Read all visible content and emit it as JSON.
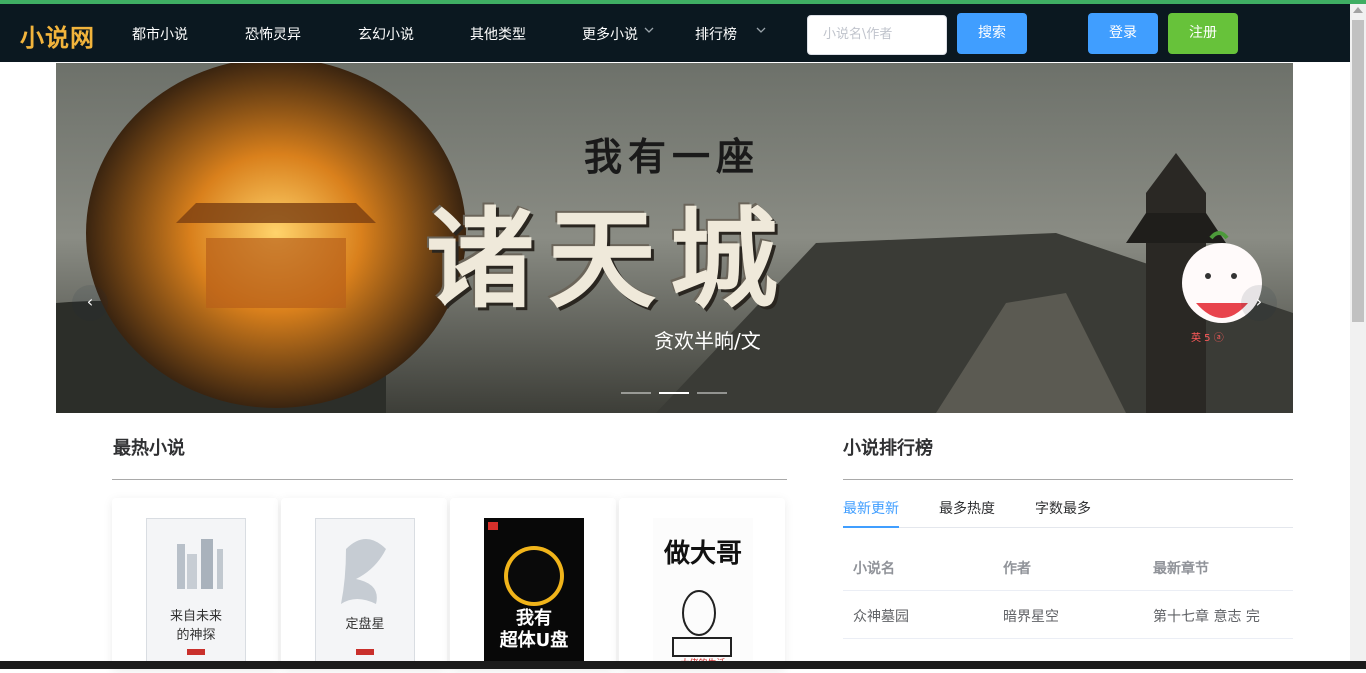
{
  "app": {
    "logo": "小说网"
  },
  "nav": {
    "items": [
      "都市小说",
      "恐怖灵异",
      "玄幻小说",
      "其他类型",
      "更多小说",
      "排行榜"
    ]
  },
  "search": {
    "placeholder": "小说名\\作者",
    "button": "搜索"
  },
  "auth": {
    "login": "登录",
    "register": "注册"
  },
  "banner": {
    "title_small": "我有一座",
    "title_big": "诸天城",
    "author": "贪欢半晌/文",
    "mascot_text": "英 5 ⓐ",
    "prev": "‹",
    "next": "›"
  },
  "hot": {
    "title": "最热小说",
    "books": [
      {
        "cover_text": "来自未来\n的神探"
      },
      {
        "cover_text": "定盘星"
      },
      {
        "cover_text": "我有超体U盘"
      },
      {
        "cover_text": "做大哥"
      }
    ]
  },
  "ranking": {
    "title": "小说排行榜",
    "tabs": [
      "最新更新",
      "最多热度",
      "字数最多"
    ],
    "columns": [
      "小说名",
      "作者",
      "最新章节"
    ],
    "rows": [
      [
        "众神墓园",
        "暗界星空",
        "第十七章 意志 完"
      ]
    ]
  },
  "colors": {
    "navbar": "#0b1820",
    "logo": "#f2b43c",
    "primary": "#409eff",
    "success": "#67c23a"
  }
}
